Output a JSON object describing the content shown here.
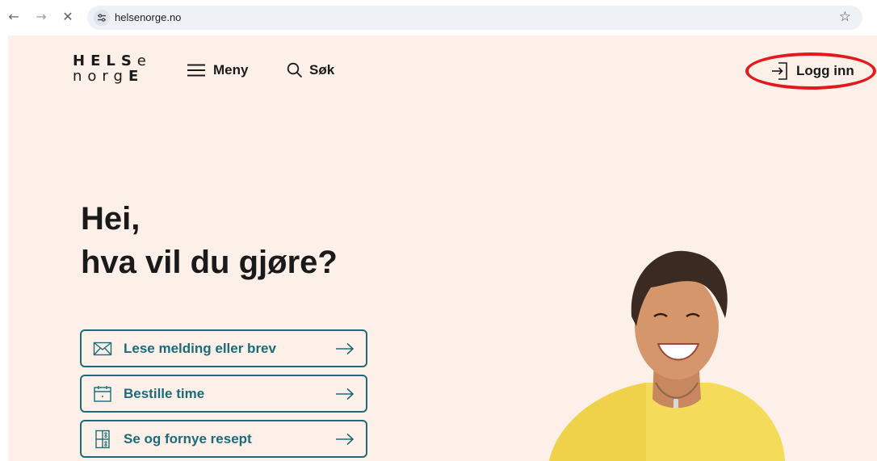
{
  "browser": {
    "url": "helsenorge.no",
    "back_icon": "arrow-left-icon",
    "forward_icon": "arrow-right-icon",
    "close_icon": "close-icon",
    "bookmark_icon": "star-icon"
  },
  "header": {
    "logo_line1": "HELSe",
    "logo_line2": "norgE",
    "menu_label": "Meny",
    "search_label": "Søk",
    "login_label": "Logg inn"
  },
  "hero": {
    "line1": "Hei,",
    "line2": "hva vil du gjøre?"
  },
  "actions": [
    {
      "label": "Lese melding eller brev",
      "icon": "envelope-icon"
    },
    {
      "label": "Bestille time",
      "icon": "calendar-icon"
    },
    {
      "label": "Se og fornye resept",
      "icon": "prescription-icon"
    }
  ],
  "colors": {
    "page_background": "#fdf0e9",
    "accent": "#1b6b7a",
    "highlight": "#e3191d"
  }
}
